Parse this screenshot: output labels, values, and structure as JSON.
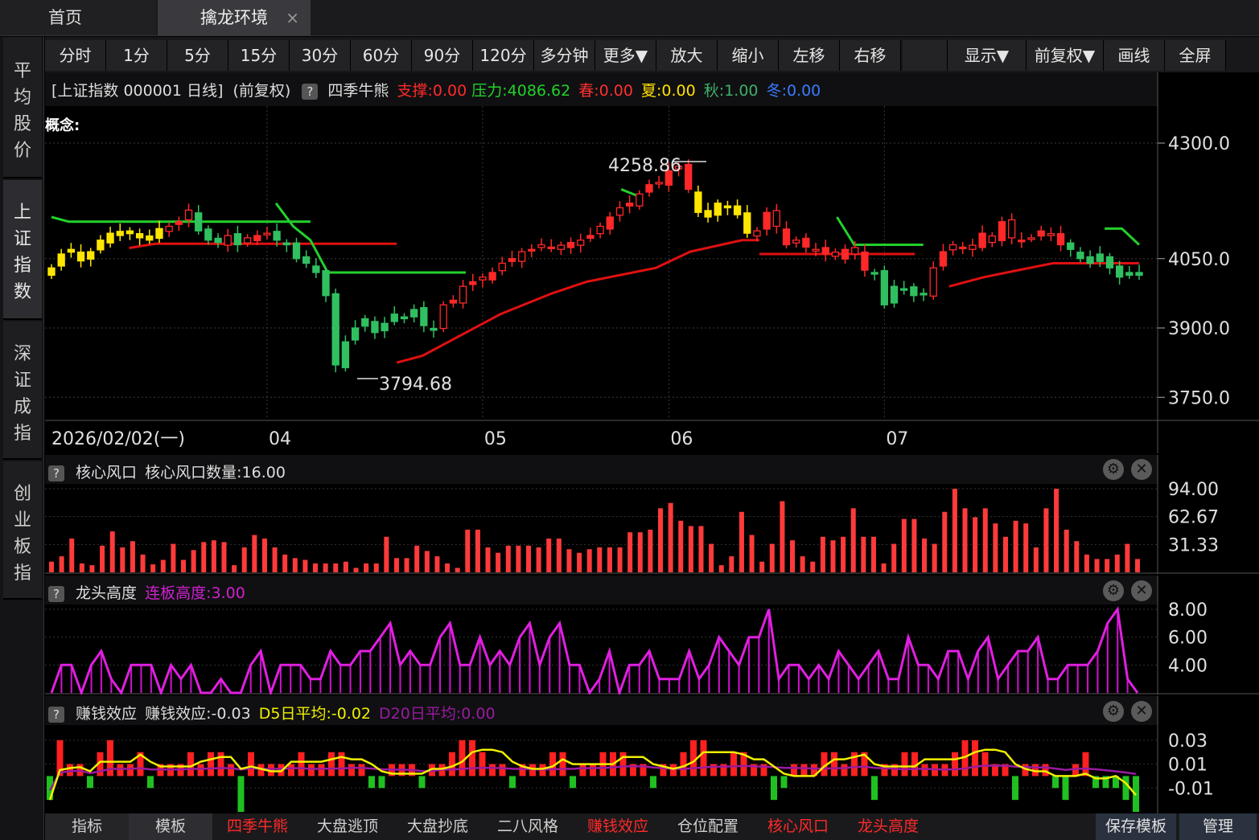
{
  "tabs": {
    "home": "首页",
    "active": "擒龙环境",
    "close": "×"
  },
  "sidebar": [
    {
      "label": "平均股价",
      "active": false
    },
    {
      "label": "上证指数",
      "active": true
    },
    {
      "label": "深证成指",
      "active": false
    },
    {
      "label": "创业板指",
      "active": false
    }
  ],
  "toolbar": [
    "分时",
    "1分",
    "5分",
    "15分",
    "30分",
    "60分",
    "90分",
    "120分",
    "多分钟",
    "更多▼",
    "放大",
    "缩小",
    "左移",
    "右移",
    "",
    "显示▼",
    "前复权▼",
    "画线",
    "全屏"
  ],
  "main_header": {
    "title": "[上证指数 000001 日线]",
    "adjust": "(前复权)",
    "help": "?",
    "indicator": "四季牛熊",
    "support": "支撑:0.00",
    "pressure": "压力:4086.62",
    "spring": "春:0.00",
    "summer": "夏:0.00",
    "autumn": "秋:1.00",
    "winter": "冬:0.00",
    "concept": "概念:",
    "colors": {
      "support": "#ff2a2a",
      "pressure": "#22d12b",
      "spring": "#ff3030",
      "summer": "#ffe000",
      "autumn": "#3fb06a",
      "winter": "#3a7aff"
    }
  },
  "main_chart": {
    "type": "candlestick",
    "yticks": [
      "4300.0",
      "4050.0",
      "3900.0",
      "3750.0"
    ],
    "xticks": [
      "2026/02/02(一)",
      "04",
      "05",
      "06",
      "07"
    ],
    "high_label": "4258.86",
    "low_label": "3794.68"
  },
  "panel1": {
    "help": "?",
    "title": "核心风口",
    "value": "核心风口数量:16.00",
    "yticks": [
      "94.00",
      "62.67",
      "31.33"
    ]
  },
  "panel2": {
    "help": "?",
    "title": "龙头高度",
    "value": "连板高度:3.00",
    "yticks": [
      "8.00",
      "6.00",
      "4.00"
    ]
  },
  "panel3": {
    "help": "?",
    "title": "赚钱效应",
    "value": "赚钱效应:-0.03",
    "d5": "D5日平均:-0.02",
    "d20": "D20日平均:0.00",
    "yticks": [
      "0.03",
      "0.01",
      "-0.01"
    ]
  },
  "bottom": [
    {
      "label": "指标",
      "color": "#d0d0d0"
    },
    {
      "label": "模板",
      "color": "#d0d0d0"
    },
    {
      "label": "四季牛熊",
      "color": "#ff2a2a"
    },
    {
      "label": "大盘逃顶",
      "color": "#d0d0d0"
    },
    {
      "label": "大盘抄底",
      "color": "#d0d0d0"
    },
    {
      "label": "二八风格",
      "color": "#d0d0d0"
    },
    {
      "label": "赚钱效应",
      "color": "#ff2a2a"
    },
    {
      "label": "仓位配置",
      "color": "#d0d0d0"
    },
    {
      "label": "核心风口",
      "color": "#ff2a2a"
    },
    {
      "label": "龙头高度",
      "color": "#ff2a2a"
    }
  ],
  "bottom_right": [
    "保存模板",
    "管理"
  ],
  "chart_data": [
    {
      "type": "candlestick",
      "title": "上证指数 000001 日线",
      "ylim": [
        3750,
        4300
      ],
      "x_months": [
        "2026/02/02(一)",
        "04",
        "05",
        "06",
        "07"
      ],
      "max": 4258.86,
      "min": 3794.68,
      "closes": [
        4030,
        4060,
        4070,
        4045,
        4065,
        4090,
        4105,
        4100,
        4110,
        4095,
        4090,
        4115,
        4120,
        4130,
        4155,
        4110,
        4090,
        4085,
        4100,
        4080,
        4095,
        4100,
        4105,
        4090,
        4080,
        4050,
        4040,
        4020,
        3970,
        3820,
        3870,
        3900,
        3920,
        3890,
        3910,
        3930,
        3920,
        3940,
        3905,
        3895,
        3950,
        3960,
        3990,
        4000,
        4010,
        4020,
        4040,
        4050,
        4065,
        4070,
        4080,
        4075,
        4070,
        4085,
        4090,
        4100,
        4120,
        4140,
        4160,
        4170,
        4190,
        4210,
        4215,
        4240,
        4250,
        4200,
        4150,
        4140,
        4170,
        4160,
        4145,
        4105,
        4110,
        4150,
        4120,
        4080,
        4090,
        4075,
        4070,
        4060,
        4055,
        4070,
        4060,
        4025,
        4020,
        3950,
        3990,
        3985,
        3970,
        3975,
        4030,
        4065,
        4080,
        4075,
        4070,
        4105,
        4085,
        4130,
        4095,
        4090,
        4095,
        4110,
        4100,
        4080,
        4070,
        4050,
        4040,
        4060,
        4030,
        4010,
        4020,
        4020
      ],
      "support_lines": "red step lines below price",
      "pressure_lines": "green step lines above price"
    },
    {
      "type": "bar",
      "title": "核心风口",
      "ylim": [
        0,
        94
      ],
      "values": [
        12,
        18,
        38,
        10,
        8,
        30,
        46,
        28,
        35,
        20,
        9,
        14,
        32,
        14,
        25,
        34,
        36,
        34,
        8,
        28,
        42,
        38,
        28,
        20,
        16,
        14,
        10,
        10,
        10,
        12,
        5,
        10,
        10,
        40,
        16,
        16,
        30,
        24,
        18,
        10,
        5,
        48,
        48,
        28,
        22,
        30,
        30,
        30,
        28,
        38,
        38,
        26,
        22,
        26,
        28,
        28,
        28,
        45,
        45,
        48,
        72,
        78,
        58,
        52,
        52,
        32,
        8,
        18,
        68,
        42,
        12,
        32,
        80,
        36,
        18,
        12,
        40,
        36,
        40,
        72,
        40,
        40,
        10,
        32,
        60,
        60,
        38,
        32,
        68,
        94,
        72,
        62,
        72,
        55,
        40,
        58,
        55,
        28,
        72,
        94,
        48,
        35,
        20,
        15,
        15,
        20,
        32,
        15
      ]
    },
    {
      "type": "line",
      "title": "龙头高度",
      "ylim": [
        2,
        8
      ],
      "values": [
        2,
        4,
        4,
        2,
        4,
        5,
        3,
        2,
        4,
        4,
        4,
        2,
        4,
        3,
        4,
        2,
        2,
        3,
        2,
        2,
        4,
        5,
        2,
        4,
        4,
        4,
        3,
        3,
        5,
        4,
        4,
        5,
        5,
        6,
        7,
        4,
        5,
        4,
        4,
        6,
        7,
        4,
        4,
        6,
        4,
        5,
        4,
        6,
        7,
        4,
        6,
        7,
        4,
        4,
        2,
        3,
        5,
        2,
        4,
        4,
        5,
        3,
        3,
        3,
        5,
        3,
        4,
        6,
        5,
        4,
        6,
        6,
        8,
        3,
        4,
        4,
        3,
        4,
        3,
        5,
        4,
        3,
        4,
        5,
        3,
        3,
        6,
        4,
        4,
        3,
        5,
        5,
        3,
        5,
        6,
        3,
        4,
        5,
        5,
        6,
        3,
        3,
        4,
        4,
        4,
        5,
        7,
        8,
        3,
        2
      ]
    },
    {
      "type": "bar",
      "title": "赚钱效应",
      "ylim": [
        -0.03,
        0.04
      ],
      "series": [
        {
          "name": "赚钱效应",
          "values": [
            -0.02,
            0.03,
            0.01,
            0.01,
            -0.01,
            0.02,
            0.03,
            0.01,
            0.01,
            0.02,
            -0.01,
            0.01,
            0.01,
            0.01,
            0.02,
            0.01,
            0.02,
            0.02,
            0.01,
            -0.03,
            0.02,
            0.01,
            0.01,
            0.01,
            0.01,
            0.02,
            0.01,
            0.01,
            0.02,
            0.02,
            0.01,
            0.01,
            -0.01,
            -0.01,
            0.01,
            0.01,
            0.01,
            -0.01,
            0.01,
            0.01,
            0.02,
            0.03,
            0.03,
            0.02,
            0.01,
            0.01,
            -0.01,
            0.01,
            0.01,
            0.01,
            0.02,
            0.02,
            -0.01,
            0.01,
            0.01,
            0.02,
            0.02,
            0.02,
            0.01,
            0.01,
            -0.01,
            0.01,
            0.01,
            0.02,
            0.03,
            0.03,
            0.01,
            0.01,
            0.02,
            0.02,
            0.01,
            0.01,
            -0.02,
            -0.01,
            0.01,
            0.01,
            0.01,
            0.02,
            0.02,
            0.01,
            0.02,
            0.02,
            -0.02,
            0.01,
            0.01,
            0.02,
            0.02,
            0.01,
            0.01,
            0.01,
            0.02,
            0.03,
            0.03,
            0.02,
            0.01,
            0.01,
            -0.02,
            0.01,
            0.01,
            0.01,
            -0.01,
            -0.02,
            0.01,
            0.02,
            -0.01,
            -0.01,
            -0.01,
            -0.02,
            -0.03
          ]
        },
        {
          "name": "D5日平均",
          "color": "#f0f000"
        },
        {
          "name": "D20日平均",
          "color": "#b000b0"
        }
      ]
    }
  ]
}
